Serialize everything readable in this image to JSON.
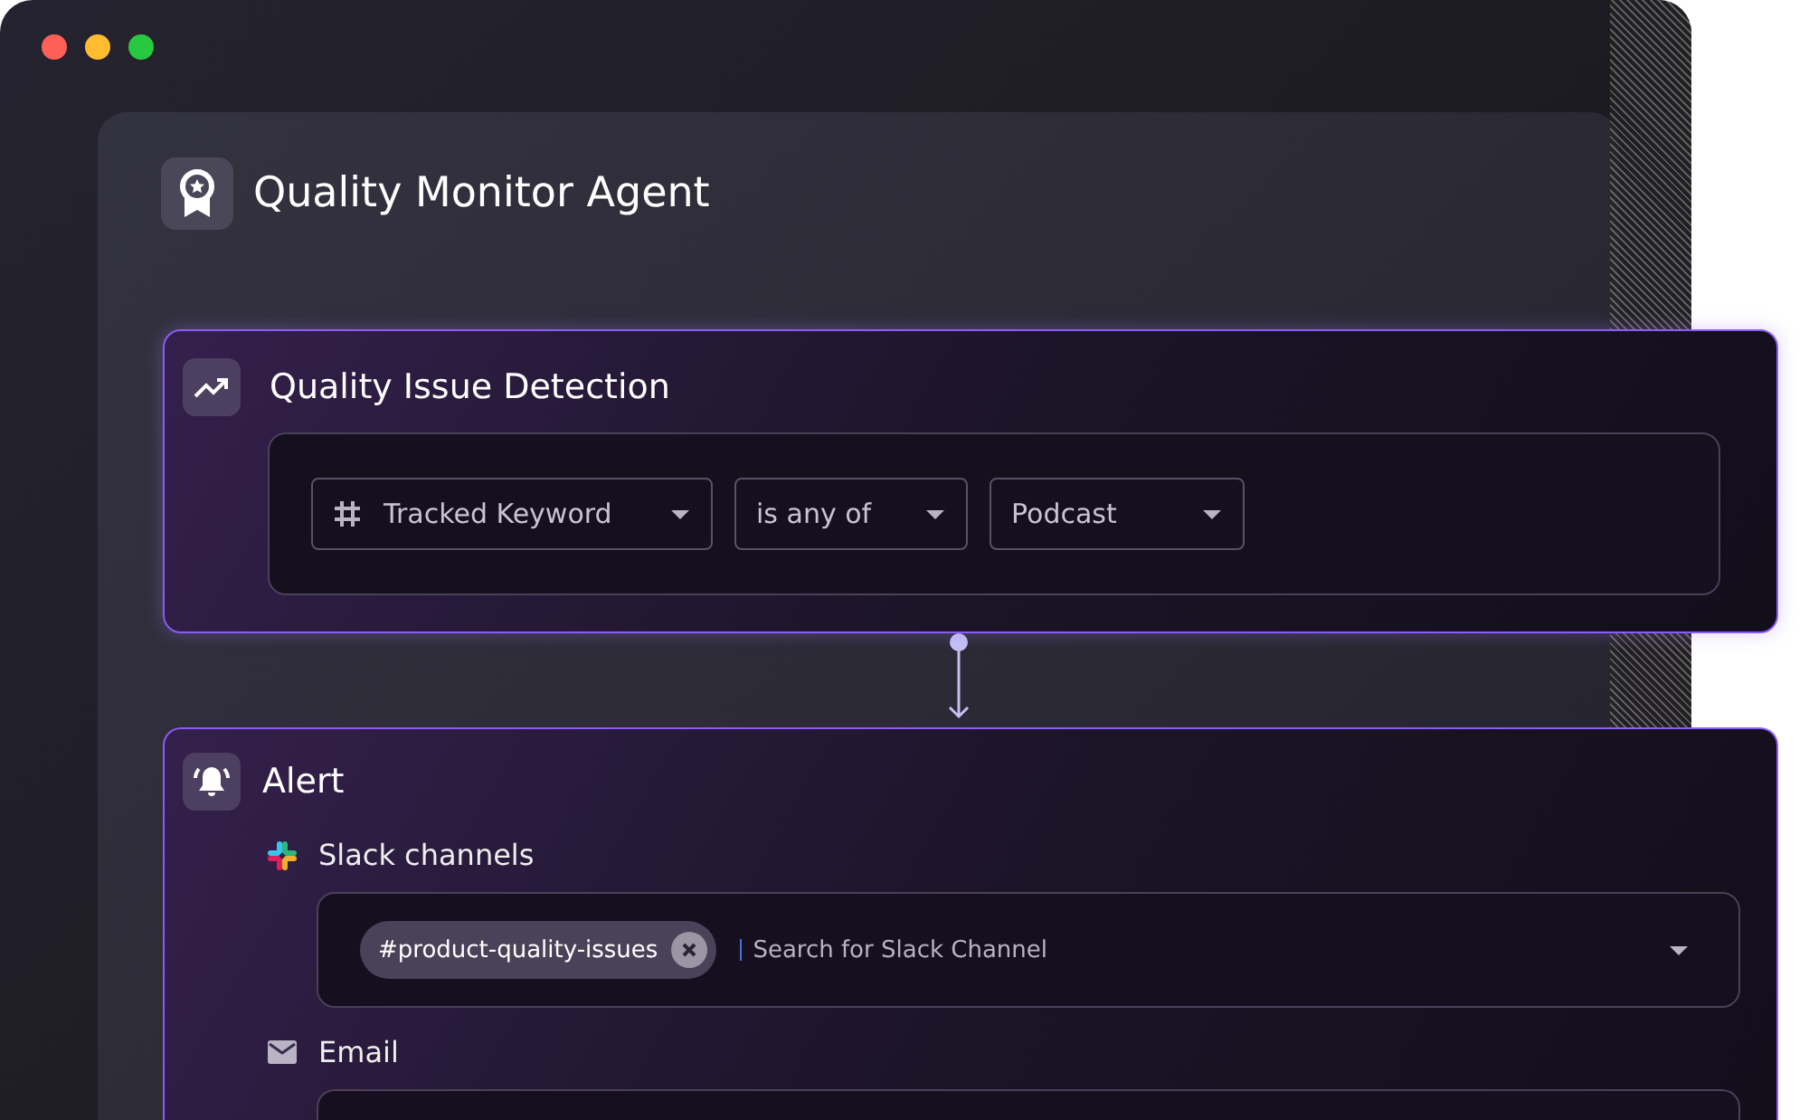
{
  "window": {
    "traffic_lights": [
      {
        "color": "#fe5f57"
      },
      {
        "color": "#febc2e"
      },
      {
        "color": "#28c840"
      }
    ]
  },
  "agent": {
    "title": "Quality Monitor Agent"
  },
  "steps": [
    {
      "kind": "trigger",
      "title": "Quality Issue Detection",
      "filters": [
        {
          "kind": "field",
          "label": "Tracked Keyword"
        },
        {
          "kind": "operator",
          "label": "is any of"
        },
        {
          "kind": "value",
          "label": "Podcast"
        }
      ]
    },
    {
      "kind": "action",
      "title": "Alert",
      "channels": [
        {
          "kind": "slack",
          "label": "Slack channels",
          "chips": [
            "#product-quality-issues"
          ],
          "placeholder": "Search for Slack Channel"
        },
        {
          "kind": "email",
          "label": "Email"
        }
      ]
    }
  ]
}
